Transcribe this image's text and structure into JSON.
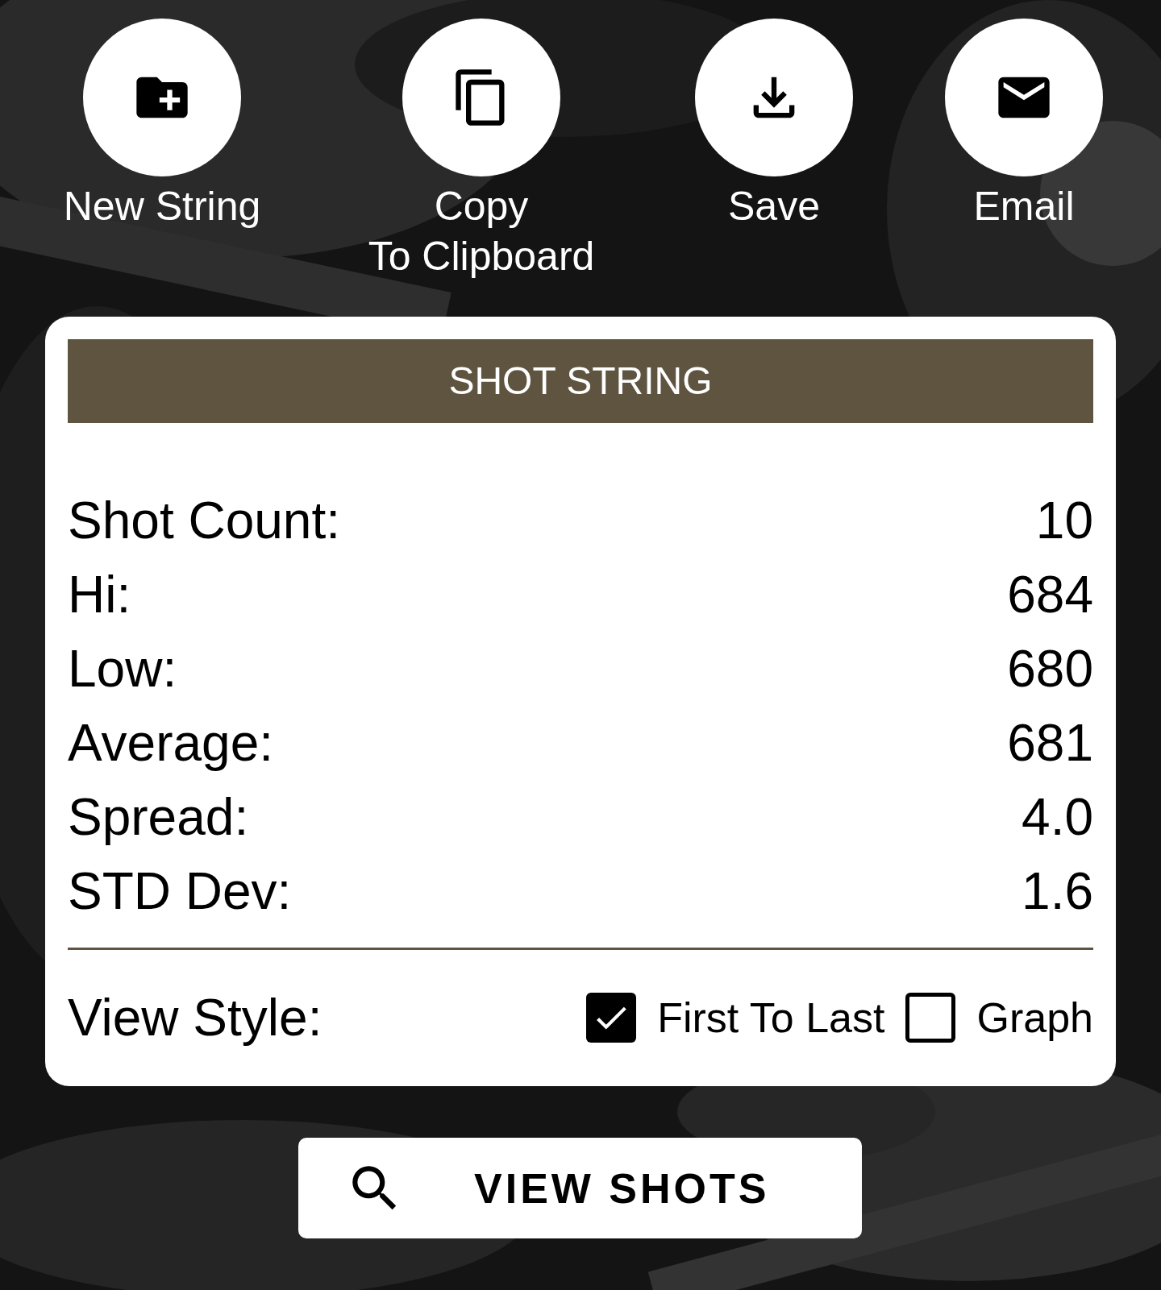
{
  "actions": [
    {
      "kind": "folder",
      "label": "New String"
    },
    {
      "kind": "copy",
      "label": "Copy\nTo Clipboard"
    },
    {
      "kind": "download",
      "label": "Save"
    },
    {
      "kind": "mail",
      "label": "Email"
    }
  ],
  "card": {
    "title": "SHOT STRING",
    "stats": [
      {
        "label": "Shot Count:",
        "value": "10"
      },
      {
        "label": "Hi:",
        "value": "684"
      },
      {
        "label": "Low:",
        "value": "680"
      },
      {
        "label": "Average:",
        "value": "681"
      },
      {
        "label": "Spread:",
        "value": "4.0"
      },
      {
        "label": "STD Dev:",
        "value": "1.6"
      }
    ],
    "view_style": {
      "label": "View Style:",
      "options": [
        {
          "label": "First To Last",
          "checked": true
        },
        {
          "label": "Graph",
          "checked": false
        }
      ]
    }
  },
  "button": {
    "label": "VIEW SHOTS"
  }
}
